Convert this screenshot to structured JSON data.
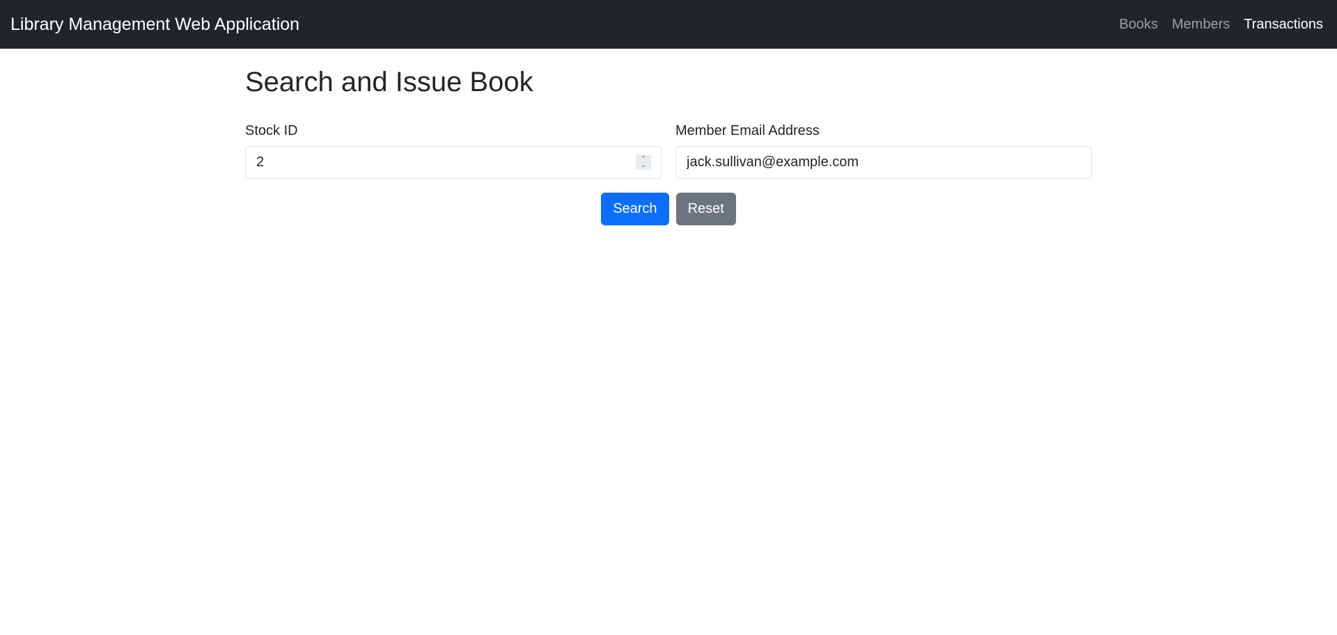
{
  "navbar": {
    "brand": "Library Management Web Application",
    "links": [
      {
        "label": "Books",
        "active": false
      },
      {
        "label": "Members",
        "active": false
      },
      {
        "label": "Transactions",
        "active": true
      }
    ]
  },
  "page": {
    "title": "Search and Issue Book"
  },
  "form": {
    "stock_id": {
      "label": "Stock ID",
      "value": "2"
    },
    "member_email": {
      "label": "Member Email Address",
      "value": "jack.sullivan@example.com"
    }
  },
  "actions": {
    "search_label": "Search",
    "reset_label": "Reset"
  },
  "colors": {
    "navbar_bg": "#212529",
    "primary": "#0d6efd",
    "secondary": "#6c757d"
  }
}
